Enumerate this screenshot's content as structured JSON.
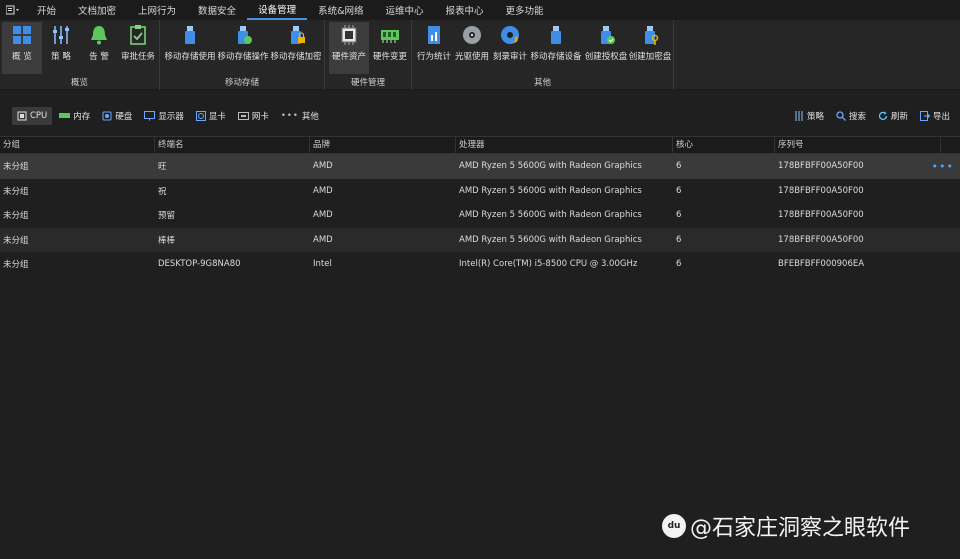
{
  "menu": {
    "items": [
      "开始",
      "文档加密",
      "上网行为",
      "数据安全",
      "设备管理",
      "系统&网络",
      "运维中心",
      "报表中心",
      "更多功能"
    ],
    "active_index": 4
  },
  "ribbon": {
    "groups": [
      {
        "label": "概览",
        "buttons": [
          "概 览",
          "策 略",
          "告 警",
          "审批任务"
        ]
      },
      {
        "label": "移动存储",
        "buttons": [
          "移动存储使用",
          "移动存储操作",
          "移动存储加密"
        ]
      },
      {
        "label": "硬件管理",
        "buttons": [
          "硬件资产",
          "硬件变更"
        ]
      },
      {
        "label": "其他",
        "buttons": [
          "行为统计",
          "光驱使用",
          "刻录审计",
          "移动存储设备",
          "创建授权盘",
          "创建加密盘"
        ]
      }
    ]
  },
  "toolbar": {
    "tabs": [
      "CPU",
      "内存",
      "硬盘",
      "显示器",
      "显卡",
      "网卡",
      "其他"
    ],
    "selected_tab": "CPU",
    "actions": [
      "策略",
      "搜索",
      "刷新",
      "导出"
    ]
  },
  "table": {
    "columns": [
      "分组",
      "终端名",
      "品牌",
      "处理器",
      "核心",
      "序列号"
    ],
    "rows": [
      [
        "未分组",
        "旺",
        "AMD",
        "AMD Ryzen 5 5600G with Radeon Graphics",
        "6",
        "178BFBFF00A50F00"
      ],
      [
        "未分组",
        "祝",
        "AMD",
        "AMD Ryzen 5 5600G with Radeon Graphics",
        "6",
        "178BFBFF00A50F00"
      ],
      [
        "未分组",
        "预留",
        "AMD",
        "AMD Ryzen 5 5600G with Radeon Graphics",
        "6",
        "178BFBFF00A50F00"
      ],
      [
        "未分组",
        "棒棒",
        "AMD",
        "AMD Ryzen 5 5600G with Radeon Graphics",
        "6",
        "178BFBFF00A50F00"
      ],
      [
        "未分组",
        "DESKTOP-9G8NA80",
        "Intel",
        "Intel(R) Core(TM) i5-8500 CPU @ 3.00GHz",
        "6",
        "BFEBFBFF000906EA"
      ]
    ],
    "row_more": "•••"
  },
  "watermark": {
    "text": "@石家庄洞察之眼软件",
    "logo": "du"
  },
  "colors": {
    "accent": "#4a90e2",
    "background": "#1f1f1f"
  }
}
